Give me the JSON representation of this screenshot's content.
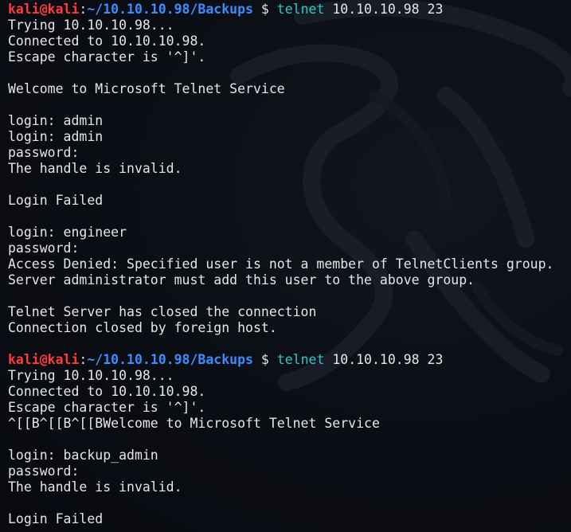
{
  "terminal": {
    "lines": [
      {
        "kind": "prompt",
        "user": "kali@kali",
        "colon": ":",
        "path": "~/10.10.10.98/Backups",
        "symbol": " $ ",
        "command": "telnet",
        "args": " 10.10.10.98 23"
      },
      {
        "kind": "text",
        "text": "Trying 10.10.10.98..."
      },
      {
        "kind": "text",
        "text": "Connected to 10.10.10.98."
      },
      {
        "kind": "text",
        "text": "Escape character is '^]'."
      },
      {
        "kind": "text",
        "text": ""
      },
      {
        "kind": "text",
        "text": "Welcome to Microsoft Telnet Service"
      },
      {
        "kind": "text",
        "text": ""
      },
      {
        "kind": "text",
        "text": "login: admin"
      },
      {
        "kind": "text",
        "text": "login: admin"
      },
      {
        "kind": "text",
        "text": "password:"
      },
      {
        "kind": "text",
        "text": "The handle is invalid."
      },
      {
        "kind": "text",
        "text": ""
      },
      {
        "kind": "text",
        "text": "Login Failed"
      },
      {
        "kind": "text",
        "text": ""
      },
      {
        "kind": "text",
        "text": "login: engineer"
      },
      {
        "kind": "text",
        "text": "password:"
      },
      {
        "kind": "text",
        "text": "Access Denied: Specified user is not a member of TelnetClients group."
      },
      {
        "kind": "text",
        "text": "Server administrator must add this user to the above group."
      },
      {
        "kind": "text",
        "text": ""
      },
      {
        "kind": "text",
        "text": "Telnet Server has closed the connection"
      },
      {
        "kind": "text",
        "text": "Connection closed by foreign host."
      },
      {
        "kind": "text",
        "text": ""
      },
      {
        "kind": "prompt",
        "user": "kali@kali",
        "colon": ":",
        "path": "~/10.10.10.98/Backups",
        "symbol": " $ ",
        "command": "telnet",
        "args": " 10.10.10.98 23"
      },
      {
        "kind": "text",
        "text": "Trying 10.10.10.98..."
      },
      {
        "kind": "text",
        "text": "Connected to 10.10.10.98."
      },
      {
        "kind": "text",
        "text": "Escape character is '^]'."
      },
      {
        "kind": "text",
        "text": "^[[B^[[B^[[BWelcome to Microsoft Telnet Service"
      },
      {
        "kind": "text",
        "text": ""
      },
      {
        "kind": "text",
        "text": "login: backup_admin"
      },
      {
        "kind": "text",
        "text": "password:"
      },
      {
        "kind": "text",
        "text": "The handle is invalid."
      },
      {
        "kind": "text",
        "text": ""
      },
      {
        "kind": "text",
        "text": "Login Failed"
      }
    ]
  },
  "colors": {
    "user": "#ff3b3b",
    "path": "#3c8dff",
    "command": "#2fc8c8",
    "text": "#e6e6e6",
    "background": "#0b0e14"
  },
  "background_art": "kali-dragon-watermark"
}
